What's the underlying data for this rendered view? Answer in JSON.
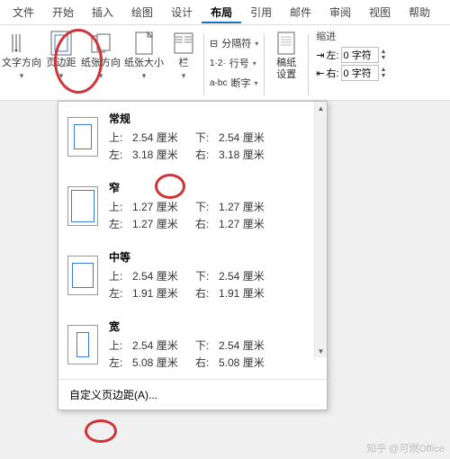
{
  "menubar": {
    "tabs": [
      "文件",
      "开始",
      "插入",
      "绘图",
      "设计",
      "布局",
      "引用",
      "邮件",
      "审阅",
      "视图",
      "帮助"
    ],
    "active_index": 5
  },
  "ribbon": {
    "text_direction": "文字方向",
    "margins": "页边距",
    "orientation": "纸张方向",
    "size": "纸张大小",
    "columns": "栏",
    "breaks": "分隔符",
    "line_numbers": "行号",
    "hyphenation": "断字",
    "paper_settings": "稿纸\n设置",
    "indent_title": "缩进",
    "indent_left_label": "左:",
    "indent_right_label": "右:",
    "indent_left_value": "0 字符",
    "indent_right_value": "0 字符"
  },
  "presets": [
    {
      "thumb": "normal",
      "name": "常规",
      "top_l": "上:",
      "top_v": "2.54 厘米",
      "bot_l": "下:",
      "bot_v": "2.54 厘米",
      "left_l": "左:",
      "left_v": "3.18 厘米",
      "right_l": "右:",
      "right_v": "3.18 厘米"
    },
    {
      "thumb": "narrow",
      "name": "窄",
      "top_l": "上:",
      "top_v": "1.27 厘米",
      "bot_l": "下:",
      "bot_v": "1.27 厘米",
      "left_l": "左:",
      "left_v": "1.27 厘米",
      "right_l": "右:",
      "right_v": "1.27 厘米"
    },
    {
      "thumb": "moderate",
      "name": "中等",
      "top_l": "上:",
      "top_v": "2.54 厘米",
      "bot_l": "下:",
      "bot_v": "2.54 厘米",
      "left_l": "左:",
      "left_v": "1.91 厘米",
      "right_l": "右:",
      "right_v": "1.91 厘米"
    },
    {
      "thumb": "wide",
      "name": "宽",
      "top_l": "上:",
      "top_v": "2.54 厘米",
      "bot_l": "下:",
      "bot_v": "2.54 厘米",
      "left_l": "左:",
      "left_v": "5.08 厘米",
      "right_l": "右:",
      "right_v": "5.08 厘米"
    }
  ],
  "custom_margins": "自定义页边距(A)...",
  "watermark": "知乎 @可燃Office"
}
